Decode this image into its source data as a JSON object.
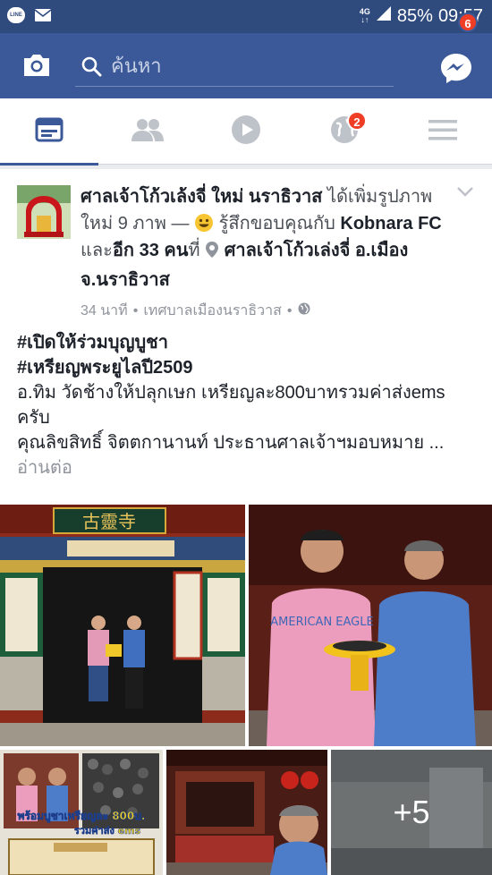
{
  "status": {
    "line_label": "LINE",
    "network": "4G",
    "battery": "85%",
    "time": "09:57"
  },
  "appbar": {
    "search_placeholder": "ค้นหา",
    "messenger_badge": "6"
  },
  "tabs": {
    "notifications_badge": "2",
    "items": [
      "news-feed",
      "friend-requests",
      "video",
      "notifications",
      "menu"
    ]
  },
  "post": {
    "page_name": "ศาลเจ้าโก้วเล้งจี่ ใหม่ นราธิวาส",
    "action_pre": " ได้เพิ่มรูปภาพใหม่ 9 ภาพ — ",
    "feeling": " รู้สึกขอบคุณกับ ",
    "tagged": "Kobnara FC",
    "and_others": " และ",
    "others_count": "อีก 33 คน",
    "at": "ที่ ",
    "location": "ศาลเจ้าโก้วเล่งจี่ อ.เมือง จ.นราธิวาส",
    "time_ago": "34 นาที",
    "place": "เทศบาลเมืองนราธิวาส",
    "hashtag1": "#เปิดให้ร่วมบุญบูชา",
    "hashtag2": "#เหรียญพระยูไลปี2509",
    "line1": "อ.ทิม วัดช้างให้ปลุกเษก   เหรียญละ800บาทรวมค่าส่งems ครับ",
    "line2": "คุณลิขสิทธิ์ จิตตกานานท์ ประธานศาลเจ้าฯมอบหมาย ...",
    "read_more": "อ่านต่อ",
    "sign_text": "古靈寺",
    "poster_text": "พร้อมบูชาเหรียญละ 800บ.",
    "poster_text2": "รวมค่าส่ง ems",
    "more_photos": "+5",
    "shirt_text": "AMERICAN EAGLE"
  },
  "colors": {
    "status_bar": "#2f4a7d",
    "app_bar": "#3b5998",
    "badge": "#f03d25"
  }
}
